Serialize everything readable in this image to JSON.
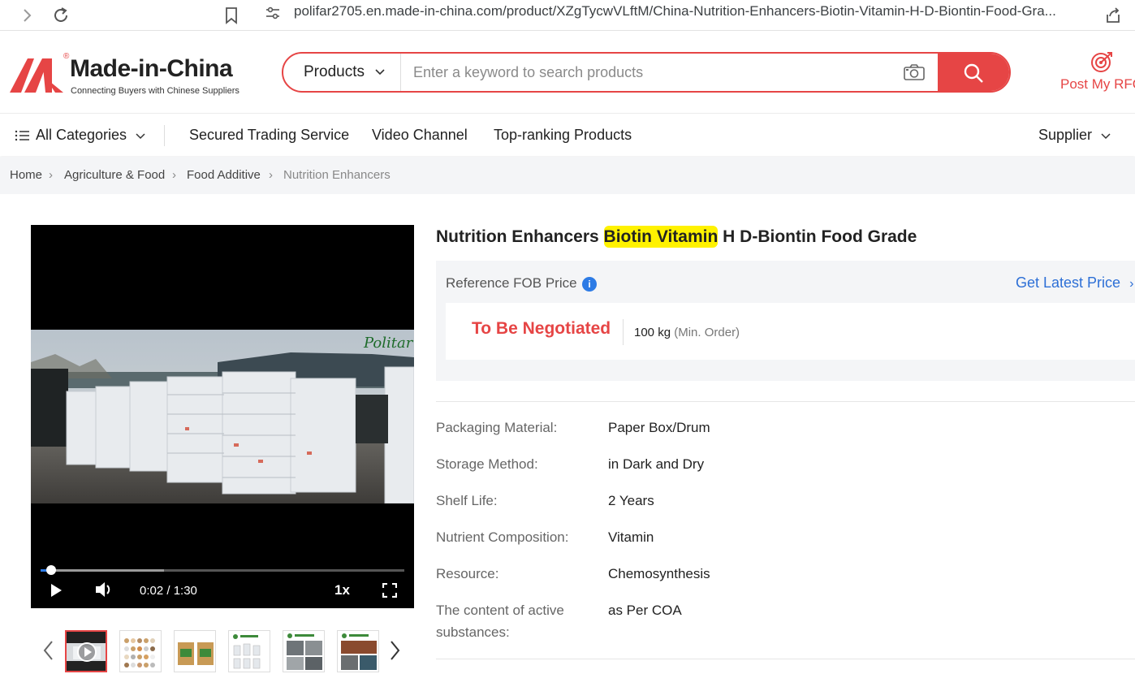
{
  "browser": {
    "url": "polifar2705.en.made-in-china.com/product/XZgTycwVLftM/China-Nutrition-Enhancers-Biotin-Vitamin-H-D-Biontin-Food-Gra..."
  },
  "header": {
    "logo_name": "Made-in-China",
    "logo_tagline": "Connecting Buyers with Chinese Suppliers",
    "search_scope": "Products",
    "search_placeholder": "Enter a keyword to search products",
    "rfq_label": "Post My RFQ"
  },
  "catnav": {
    "all_categories": "All Categories",
    "items": [
      "Secured Trading Service",
      "Video Channel",
      "Top-ranking Products"
    ],
    "supplier": "Supplier"
  },
  "breadcrumb": [
    "Home",
    "Agriculture & Food",
    "Food Additive",
    "Nutrition Enhancers"
  ],
  "video": {
    "brand_watermark": "Politar",
    "time": "0:02 / 1:30",
    "speed": "1x",
    "progress_played_fraction": 0.03,
    "progress_buffered_fraction": 0.34
  },
  "thumbnails_count": 6,
  "product": {
    "title_before": "Nutrition Enhancers ",
    "title_highlight": "Biotin Vitamin",
    "title_after": " H D-Biontin Food Grade",
    "price_label": "Reference FOB Price",
    "latest_price_link": "Get Latest Price",
    "price": "To Be Negotiated",
    "min_order_qty": "100 kg",
    "min_order_label": "(Min. Order)",
    "specs": [
      {
        "label": "Packaging Material:",
        "value": "Paper Box/Drum"
      },
      {
        "label": "Storage Method:",
        "value": "in Dark and Dry"
      },
      {
        "label": "Shelf Life:",
        "value": "2 Years"
      },
      {
        "label": "Nutrient Composition:",
        "value": "Vitamin"
      },
      {
        "label": "Resource:",
        "value": "Chemosynthesis"
      },
      {
        "label": "The content of active substances:",
        "value": "as Per COA"
      }
    ]
  },
  "colors": {
    "brand_red": "#e64545",
    "link_blue": "#2d6fd6",
    "highlight_yellow": "#fff200"
  }
}
